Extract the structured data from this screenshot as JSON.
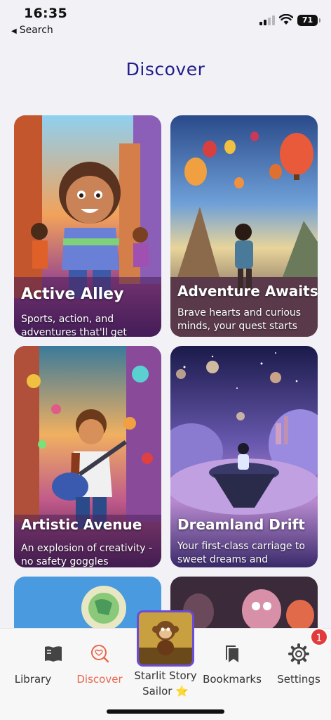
{
  "status": {
    "time": "16:35",
    "back_label": "Search",
    "battery": "71"
  },
  "page": {
    "title": "Discover"
  },
  "cards": [
    {
      "title": "Active Alley",
      "desc": "Sports, action, and adventures that'll get"
    },
    {
      "title": "Adventure Awaits",
      "desc": "Brave hearts and curious minds, your quest starts"
    },
    {
      "title": "Artistic Avenue",
      "desc": "An explosion of creativity - no safety goggles"
    },
    {
      "title": "Dreamland Drift",
      "desc": "Your first-class carriage to sweet dreams and"
    }
  ],
  "tabs": {
    "library": "Library",
    "discover": "Discover",
    "center_line1": "Starlit Story",
    "center_line2": "Sailor ⭐",
    "bookmarks": "Bookmarks",
    "settings": "Settings",
    "settings_badge": "1"
  },
  "colors": {
    "accent": "#e8674c",
    "title": "#1f1e8a",
    "badge": "#e23b3b",
    "center_border": "#6b4cd9"
  }
}
